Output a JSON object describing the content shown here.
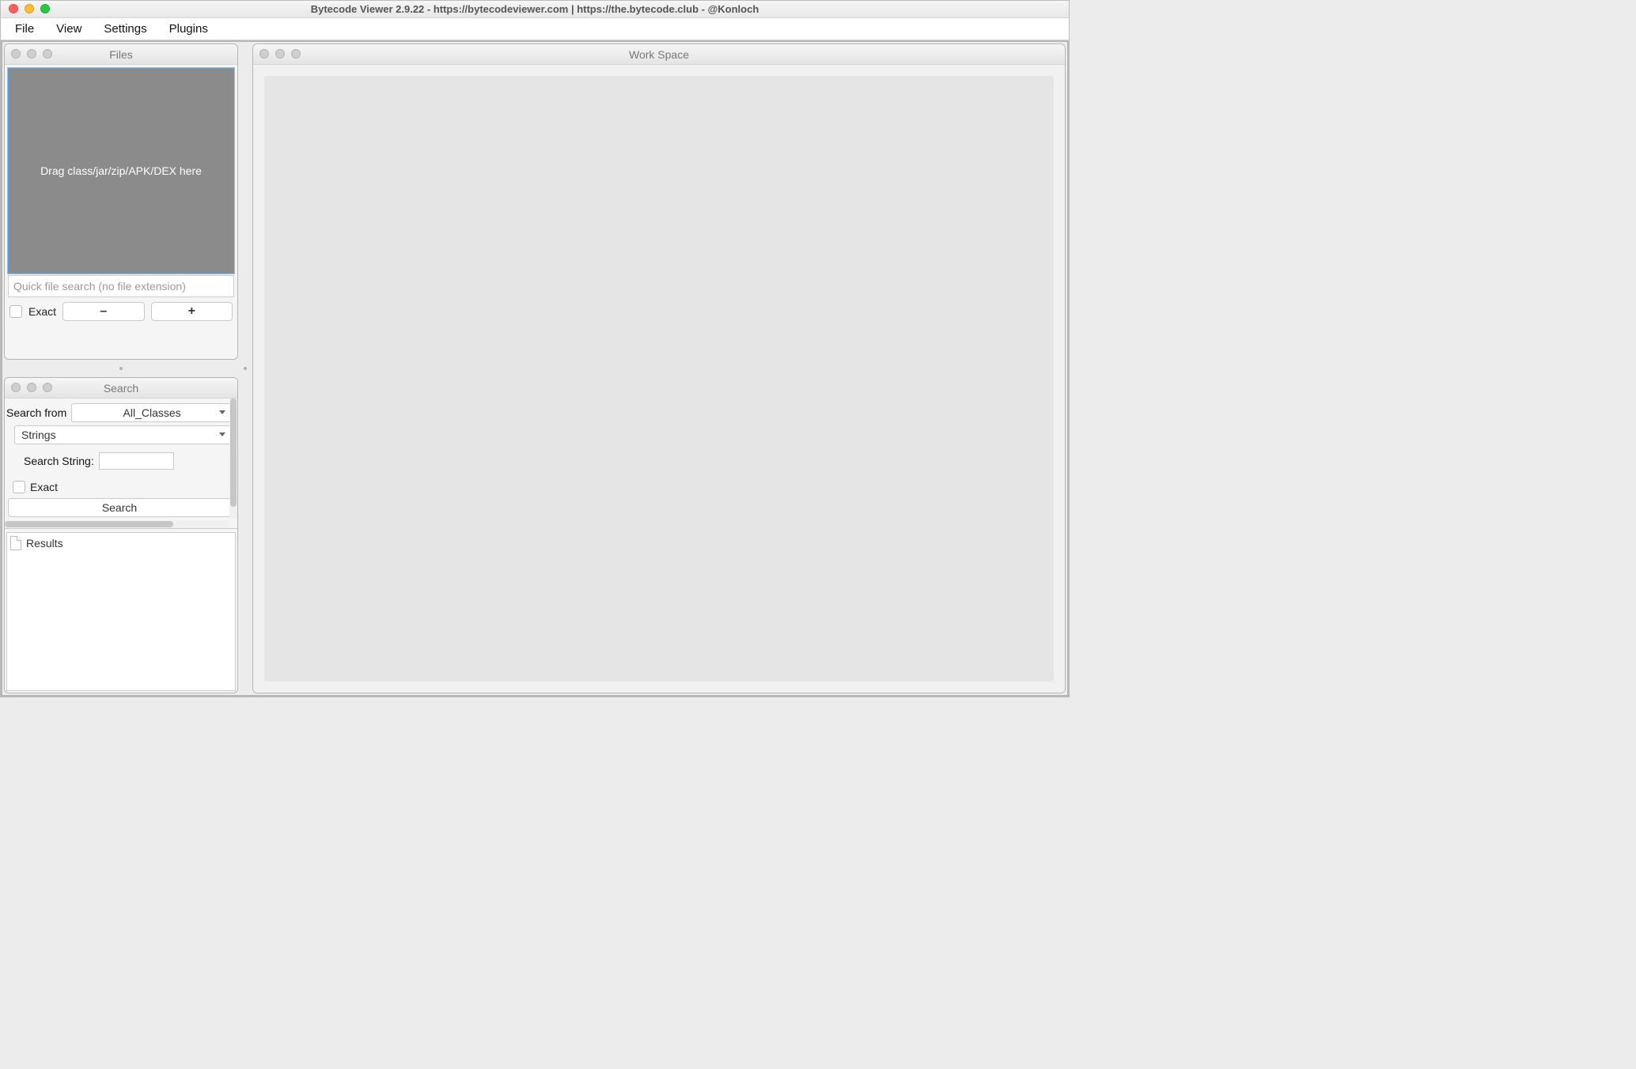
{
  "window": {
    "title": "Bytecode Viewer 2.9.22 - https://bytecodeviewer.com | https://the.bytecode.club - @Konloch"
  },
  "menubar": {
    "items": [
      "File",
      "View",
      "Settings",
      "Plugins"
    ]
  },
  "files_panel": {
    "title": "Files",
    "drop_hint": "Drag class/jar/zip/APK/DEX here",
    "quick_search_placeholder": "Quick file search (no file extension)",
    "exact_label": "Exact",
    "collapse_label": "–",
    "expand_label": "+"
  },
  "search_panel": {
    "title": "Search",
    "from_label": "Search from",
    "from_value": "All_Classes",
    "type_value": "Strings",
    "string_label": "Search String:",
    "exact_label": "Exact",
    "search_button": "Search",
    "results_label": "Results"
  },
  "workspace_panel": {
    "title": "Work Space"
  }
}
